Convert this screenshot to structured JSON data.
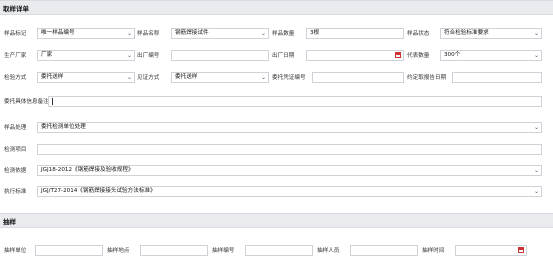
{
  "sections": {
    "detail_title": "取样详单",
    "sampling_title": "抽样"
  },
  "row1": {
    "sample_mark_label": "样品标记",
    "sample_mark_value": "唯一样品编号",
    "sample_name_label": "样品名称",
    "sample_name_value": "钢筋焊接试件",
    "sample_qty_label": "样品数量",
    "sample_qty_value": "3根",
    "sample_state_label": "样品状态",
    "sample_state_value": "符合检验标准要求"
  },
  "row2": {
    "manufacturer_label": "生产厂家",
    "manufacturer_value": "厂家",
    "factory_no_label": "出厂编号",
    "factory_no_value": "",
    "factory_date_label": "出厂日期",
    "factory_date_value": "",
    "rep_qty_label": "代表数量",
    "rep_qty_value": "300个"
  },
  "row3": {
    "test_method_label": "检验方式",
    "test_method_value": "委托送样",
    "witness_method_label": "见证方式",
    "witness_method_value": "委托送样",
    "witness_cert_label": "委托凭证编号",
    "witness_cert_value": "",
    "report_date_label": "约定取报告日期",
    "report_date_value": ""
  },
  "commission_info": {
    "label": "委托具体信息备注",
    "value": ""
  },
  "sample_handling": {
    "label": "样品处理",
    "value": "委托检测单位处理"
  },
  "test_items": {
    "label": "检测项目",
    "value": ""
  },
  "test_basis": {
    "label": "检测依据",
    "value": "JGJ18-2012《钢筋焊接及验收规程》"
  },
  "exec_standard": {
    "label": "执行标准",
    "value": "JGJ/T27-2014《钢筋焊接接头试验方法标准》"
  },
  "sampling": {
    "unit_label": "抽样单位",
    "place_label": "抽样地点",
    "no_label": "抽样编号",
    "person_label": "抽样人员",
    "time_label": "抽样时间"
  },
  "icons": {
    "dropdown": "chevron-down-icon",
    "date": "calendar-icon"
  }
}
